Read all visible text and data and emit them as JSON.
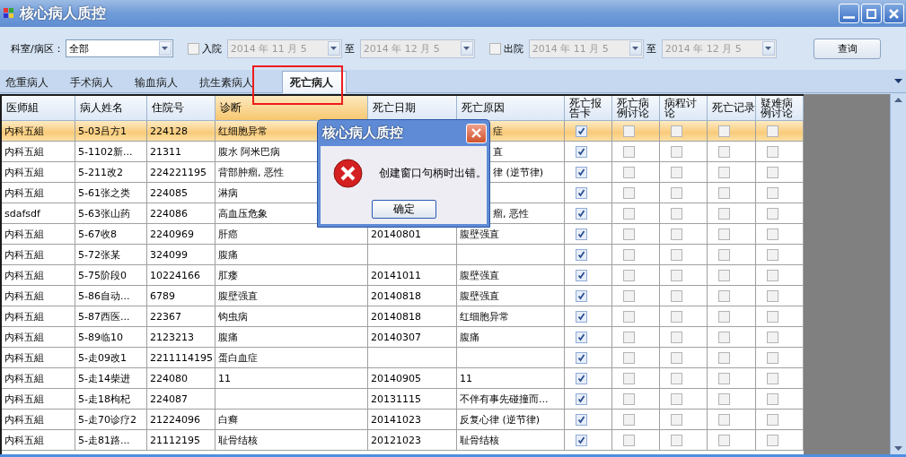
{
  "window": {
    "title": "核心病人质控"
  },
  "toolbar": {
    "dept_label": "科室/病区：",
    "dept_value": "全部",
    "filters": [
      {
        "label": "入院",
        "checked": false,
        "from": "2014 年 11 月 5",
        "to_label": "至",
        "to": "2014 年 12 月 5"
      },
      {
        "label": "出院",
        "checked": false,
        "from": "2014 年 11 月 5",
        "to_label": "至",
        "to": "2014 年 12 月 5"
      }
    ],
    "query_button": "查询"
  },
  "tabs": [
    {
      "label": "危重病人",
      "selected": false
    },
    {
      "label": "手术病人",
      "selected": false
    },
    {
      "label": "输血病人",
      "selected": false
    },
    {
      "label": "抗生素病人",
      "selected": false
    },
    {
      "label": "死亡病人",
      "selected": true
    }
  ],
  "table": {
    "columns": [
      {
        "label": "医师組",
        "sorted": false
      },
      {
        "label": "病人姓名",
        "sorted": false
      },
      {
        "label": "住院号",
        "sorted": false
      },
      {
        "label": "诊断",
        "sorted": true
      },
      {
        "label": "死亡日期",
        "sorted": false
      },
      {
        "label": "死亡原因",
        "sorted": false
      },
      {
        "label": "死亡报告卡",
        "sorted": false
      },
      {
        "label": "死亡病例讨论",
        "sorted": false
      },
      {
        "label": "病程讨论",
        "sorted": false
      },
      {
        "label": "死亡记录",
        "sorted": false
      },
      {
        "label": "疑难病例讨论",
        "sorted": false
      }
    ],
    "rows": [
      {
        "selected": true,
        "cells": [
          "内科五組",
          "5-03吕方1",
          "224128",
          "红细胞异常",
          null,
          "症"
        ],
        "checks": [
          {
            "checked": true
          },
          {
            "checked": false
          },
          {
            "checked": false
          },
          {
            "checked": false
          },
          {
            "checked": false
          }
        ]
      },
      {
        "selected": false,
        "cells": [
          "内科五組",
          "5-1102新...",
          "21311",
          "腹水 阿米巴病",
          null,
          "直"
        ],
        "checks": [
          {
            "checked": true
          },
          {
            "checked": false
          },
          {
            "checked": false
          },
          {
            "checked": false
          },
          {
            "checked": false
          }
        ]
      },
      {
        "selected": false,
        "cells": [
          "内科五組",
          "5-211改2",
          "224221195",
          "背部肿瘤, 恶性",
          null,
          "律 (逆节律)"
        ],
        "checks": [
          {
            "checked": true
          },
          {
            "checked": false
          },
          {
            "checked": false
          },
          {
            "checked": false
          },
          {
            "checked": false
          }
        ]
      },
      {
        "selected": false,
        "cells": [
          "内科五組",
          "5-61张之类",
          "224085",
          "淋病",
          null,
          null
        ],
        "checks": [
          {
            "checked": true
          },
          {
            "checked": false
          },
          {
            "checked": false
          },
          {
            "checked": false
          },
          {
            "checked": false
          }
        ]
      },
      {
        "selected": false,
        "cells": [
          "sdafsdf",
          "5-63张山药",
          "224086",
          "高血压危象",
          null,
          "瘤, 恶性"
        ],
        "checks": [
          {
            "checked": true
          },
          {
            "checked": false
          },
          {
            "checked": false
          },
          {
            "checked": false
          },
          {
            "checked": false
          }
        ]
      },
      {
        "selected": false,
        "cells": [
          "内科五組",
          "5-67收8",
          "2240969",
          "肝癌",
          "20140801",
          "腹壁强直"
        ],
        "checks": [
          {
            "checked": true
          },
          {
            "checked": false
          },
          {
            "checked": false
          },
          {
            "checked": false
          },
          {
            "checked": false
          }
        ]
      },
      {
        "selected": false,
        "cells": [
          "内科五組",
          "5-72张某",
          "324099",
          "腹痛",
          null,
          null
        ],
        "checks": [
          {
            "checked": true
          },
          {
            "checked": false
          },
          {
            "checked": false
          },
          {
            "checked": false
          },
          {
            "checked": false
          }
        ]
      },
      {
        "selected": false,
        "cells": [
          "内科五組",
          "5-75阶段0",
          "10224166",
          "肛瘘",
          "20141011",
          "腹壁强直"
        ],
        "checks": [
          {
            "checked": true
          },
          {
            "checked": false
          },
          {
            "checked": false
          },
          {
            "checked": false
          },
          {
            "checked": false
          }
        ]
      },
      {
        "selected": false,
        "cells": [
          "内科五組",
          "5-86自动...",
          "6789",
          "腹壁强直",
          "20140818",
          "腹壁强直"
        ],
        "checks": [
          {
            "checked": true
          },
          {
            "checked": false
          },
          {
            "checked": false
          },
          {
            "checked": false
          },
          {
            "checked": false
          }
        ]
      },
      {
        "selected": false,
        "cells": [
          "内科五組",
          "5-87西医...",
          "22367",
          "钩虫病",
          "20140818",
          "红细胞异常"
        ],
        "checks": [
          {
            "checked": true
          },
          {
            "checked": false
          },
          {
            "checked": false
          },
          {
            "checked": false
          },
          {
            "checked": false
          }
        ]
      },
      {
        "selected": false,
        "cells": [
          "内科五組",
          "5-89临10",
          "2123213",
          "腹痛",
          "20140307",
          "腹痛"
        ],
        "checks": [
          {
            "checked": true
          },
          {
            "checked": false
          },
          {
            "checked": false
          },
          {
            "checked": false
          },
          {
            "checked": false
          }
        ]
      },
      {
        "selected": false,
        "cells": [
          "内科五組",
          "5-走09改1",
          "2211114195",
          "蛋白血症",
          null,
          null
        ],
        "checks": [
          {
            "checked": true
          },
          {
            "checked": false
          },
          {
            "checked": false
          },
          {
            "checked": false
          },
          {
            "checked": false
          }
        ]
      },
      {
        "selected": false,
        "cells": [
          "内科五組",
          "5-走14柴进",
          "224080",
          "11",
          "20140905",
          "11"
        ],
        "checks": [
          {
            "checked": true
          },
          {
            "checked": false
          },
          {
            "checked": false
          },
          {
            "checked": false
          },
          {
            "checked": false
          }
        ]
      },
      {
        "selected": false,
        "cells": [
          "内科五組",
          "5-走18枸杞",
          "224087",
          null,
          "20131115",
          "不伴有事先碰撞而..."
        ],
        "checks": [
          {
            "checked": true
          },
          {
            "checked": false
          },
          {
            "checked": false
          },
          {
            "checked": false
          },
          {
            "checked": false
          }
        ]
      },
      {
        "selected": false,
        "cells": [
          "内科五組",
          "5-走70诊疗2",
          "21224096",
          "白癣",
          "20141023",
          "反复心律 (逆节律)"
        ],
        "checks": [
          {
            "checked": true
          },
          {
            "checked": false
          },
          {
            "checked": false
          },
          {
            "checked": false
          },
          {
            "checked": false
          }
        ]
      },
      {
        "selected": false,
        "cells": [
          "内科五組",
          "5-走81路...",
          "21112195",
          "耻骨结核",
          "20121023",
          "耻骨结核"
        ],
        "checks": [
          {
            "checked": true
          },
          {
            "checked": false
          },
          {
            "checked": false
          },
          {
            "checked": false
          },
          {
            "checked": false
          }
        ]
      }
    ]
  },
  "dialog": {
    "title": "核心病人质控",
    "message": "创建窗口句柄时出错。",
    "button": "确定"
  }
}
